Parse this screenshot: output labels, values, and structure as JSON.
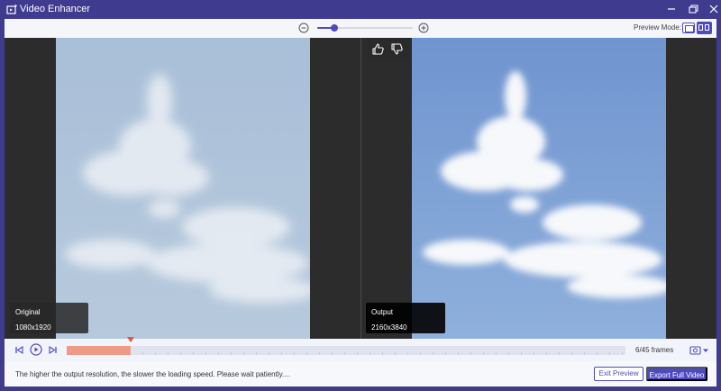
{
  "window": {
    "title": "Video Enhancer",
    "icons": [
      "app-logo-icon",
      "minimize-icon",
      "maximize-icon",
      "close-icon"
    ]
  },
  "toolbar": {
    "zoom_level": 0.18,
    "preview_mode_label": "Preview Mode:",
    "preview_mode_selected": "split",
    "icons": [
      "zoom-out-icon",
      "zoom-in-icon",
      "single-view-icon",
      "split-view-icon"
    ]
  },
  "preview": {
    "original": {
      "label": "Original",
      "resolution": "1080x1920"
    },
    "output": {
      "label": "Output",
      "resolution": "2160x3840"
    },
    "feedback_icons": [
      "thumbs-up-icon",
      "thumbs-down-icon"
    ]
  },
  "timeline": {
    "progress": 0.114,
    "frames_text": "6/45 frames",
    "icons": [
      "skip-start-icon",
      "play-icon",
      "skip-end-icon",
      "snapshot-icon"
    ]
  },
  "footer": {
    "hint": "The higher the output resolution, the slower the loading speed. Please wait patiently....",
    "exit_label": "Exit Preview",
    "export_label": "Export Full Video"
  },
  "colors": {
    "frame": "#3f3b8f",
    "accent": "#4d4ac2",
    "progress": "#ef9a86",
    "playhead": "#e4553a"
  }
}
